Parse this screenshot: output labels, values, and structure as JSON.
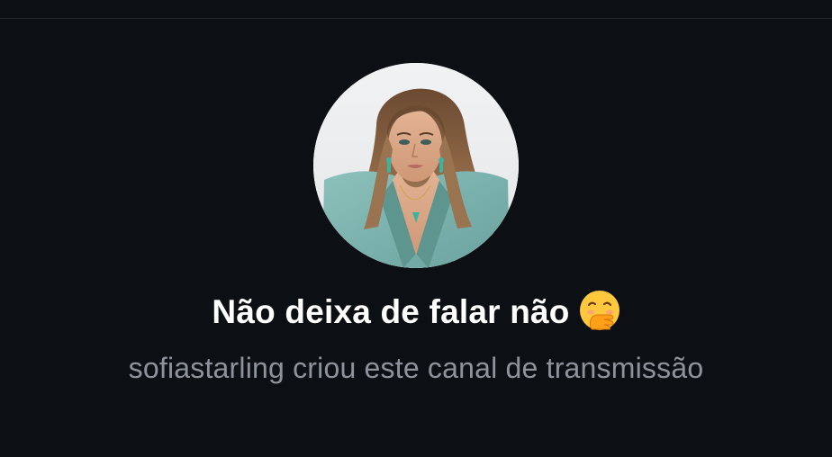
{
  "channel": {
    "title": "Não deixa de falar não",
    "title_emoji": "face-with-hand-over-mouth-icon",
    "subtitle": "sofiastarling criou este canal de transmissão",
    "avatar": "profile-photo-woman-teal-blazer"
  },
  "colors": {
    "background": "#0c0f14",
    "title": "#ffffff",
    "subtitle": "#8e939b",
    "avatar_blazer": "#7fb3ae"
  }
}
